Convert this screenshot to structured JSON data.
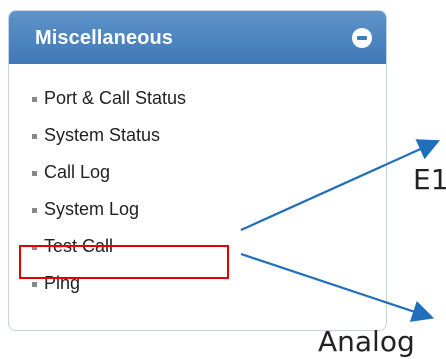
{
  "panel": {
    "title": "Miscellaneous",
    "collapse_icon": "minus-circle-icon",
    "items": [
      {
        "label": "Port & Call Status"
      },
      {
        "label": "System Status"
      },
      {
        "label": "Call Log"
      },
      {
        "label": "System Log"
      },
      {
        "label": "Test Call",
        "highlighted": true
      },
      {
        "label": "Ping"
      }
    ]
  },
  "annotations": {
    "top_label": "E1",
    "bottom_label": "Analog"
  },
  "colors": {
    "header_blue": "#4a84c1",
    "highlight_red": "#e60000",
    "arrow_blue": "#1f6fba"
  }
}
